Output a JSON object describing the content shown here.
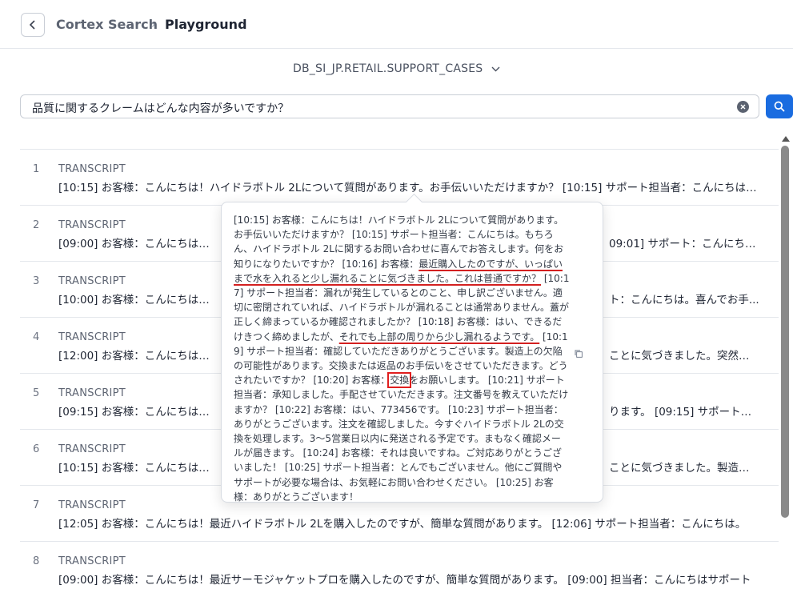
{
  "breadcrumb": {
    "parent": "Cortex Search",
    "separator": "›",
    "current": "Playground"
  },
  "table_selector": {
    "label": "DB_SI_JP.RETAIL.SUPPORT_CASES"
  },
  "search": {
    "value": "品質に関するクレームはどんな内容が多いですか？"
  },
  "results": [
    {
      "num": "1",
      "kind": "TRANSCRIPT",
      "text": "[10:15] お客様：こんにちは！ハイドラボトル 2Lについて質問があります。お手伝いいただけますか？ [10:15] サポート担当者：こんにちは。もちろん、ハイドラボトル 2Lに関するお問い合わせに喜んでお答えします。"
    },
    {
      "num": "2",
      "kind": "TRANSCRIPT",
      "text": "[09:00] お客様：こんにちは！最",
      "tail": "09:01] サポート：こんにちは..."
    },
    {
      "num": "3",
      "kind": "TRANSCRIPT",
      "text": "[10:00] お客様：こんにちは！先",
      "tail": "ト：こんにちは。喜んでお手..."
    },
    {
      "num": "4",
      "kind": "TRANSCRIPT",
      "text": "[12:00] お客様：こんにちは、最",
      "tail": "ことに気づきました。突然現..."
    },
    {
      "num": "5",
      "kind": "TRANSCRIPT",
      "text": "[09:15] お客様：こんにちは！最",
      "tail": "ります。 [09:15] サポート担..."
    },
    {
      "num": "6",
      "kind": "TRANSCRIPT",
      "text": "[10:15] お客様：こんにちは、最",
      "tail": "ことに気づきました。製造上..."
    },
    {
      "num": "7",
      "kind": "TRANSCRIPT",
      "text": "[12:05] お客様：こんにちは！最近ハイドラボトル 2Lを購入したのですが、簡単な質問があります。 [12:06] サポート担当者：こんにちは。"
    },
    {
      "num": "8",
      "kind": "TRANSCRIPT",
      "text": "[09:00] お客様：こんにちは！最近サーモジャケットプロを購入したのですが、簡単な質問があります。 [09:00] 担当者：こんにちはサポート"
    }
  ],
  "popover": {
    "p1": "[10:15] お客様：こんにちは！ハイドラボトル 2Lについて質問があります。お手伝いいただけますか？ [10:15] サポート担当者：こんにちは。もちろん、ハイドラボトル 2Lに関するお問い合わせに喜んでお答えします。何をお知りになりたいですか？ [10:16] お客様：",
    "u1": "最近購入したのですが、いっぱいまで水を入れると少し漏れることに気づきました。これは普通ですか？",
    "p2": " [10:17] サポート担当者：漏れが発生しているとのこと、申し訳ございません。適切に密閉されていれば、ハイドラボトルが漏れることは通常ありません。蓋が正しく締まっているか確認されましたか？ [10:18] お客様：はい、できるだけきつく締めましたが、",
    "u2": "それでも上部の周りから少し漏れるようです。",
    "p3": " [10:19] サポート担当者：確認していただきありがとうございます。製造上の欠陥の可能性があります。交換または返品のお手伝いをさせていただきます。どうされたいですか？ [10:20] お客様：",
    "boxed": "交換",
    "p4": "をお願いします。 [10:21] サポート担当者：承知しました。手配させていただきます。注文番号を教えていただけますか？ [10:22] お客様：はい、773456です。 [10:23] サポート担当者：ありがとうございます。注文を確認しました。今すぐハイドラボトル 2Lの交換を処理します。3〜5営業日以内に発送される予定です。まもなく確認メールが届きます。 [10:24] お客様：それは良いですね。ご対応ありがとうございました！ [10:25] サポート担当者：とんでもございません。他にご質問やサポートが必要な場合は、お気軽にお問い合わせください。 [10:25] お客様：ありがとうございます！"
  },
  "colors": {
    "accent": "#1a6ce0",
    "highlight": "#e01e1e"
  },
  "icons": {
    "back": "chevron-left-icon",
    "dropdown": "chevron-down-icon",
    "clear": "clear-circle-icon",
    "search": "search-icon",
    "copy": "copy-icon"
  }
}
